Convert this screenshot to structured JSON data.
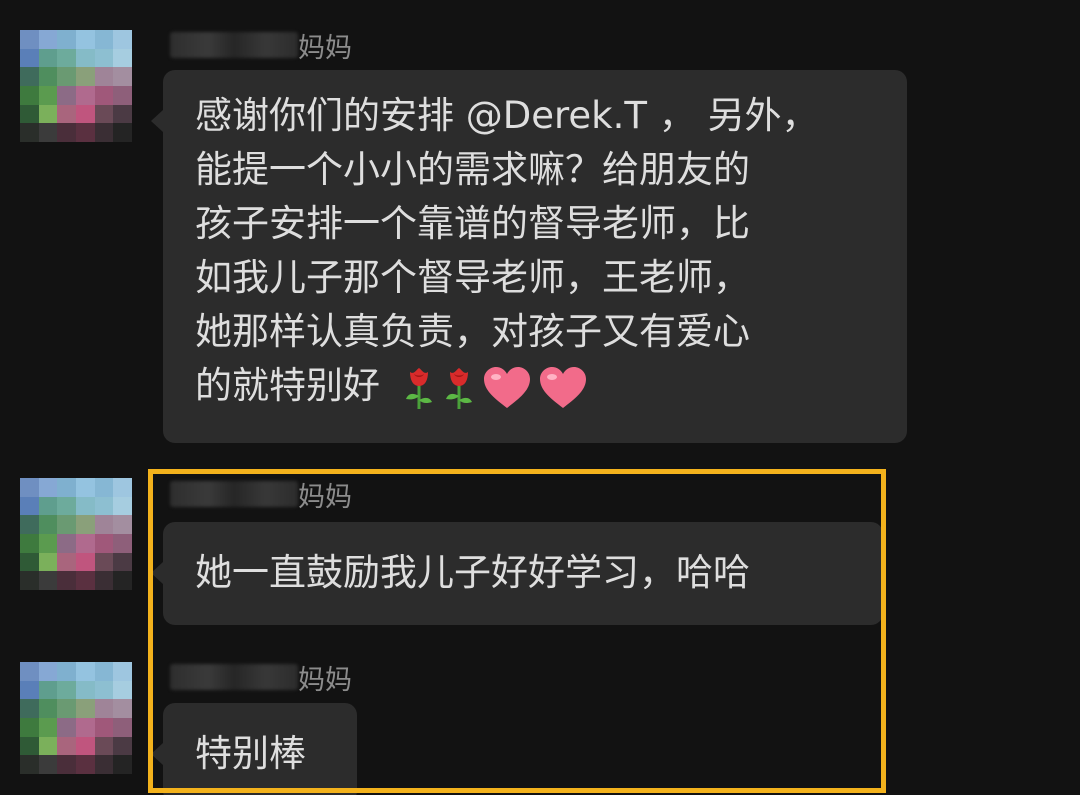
{
  "messages": [
    {
      "sender_suffix": "妈妈",
      "lines": [
        "感谢你们的安排 @Derek.T ， 另外，",
        "能提一个小小的需求嘛？给朋友的",
        "孩子安排一个靠谱的督导老师，比",
        "如我儿子那个督导老师，王老师，",
        "她那样认真负责，对孩子又有爱心",
        "的就特别好"
      ],
      "emojis": [
        "rose-emoji",
        "rose-emoji",
        "heart-emoji",
        "heart-emoji"
      ]
    },
    {
      "sender_suffix": "妈妈",
      "lines": [
        "她一直鼓励我儿子好好学习，哈哈"
      ]
    },
    {
      "sender_suffix": "妈妈",
      "lines": [
        "特别棒"
      ]
    }
  ],
  "colors": {
    "background": "#121212",
    "bubble": "#2c2c2c",
    "text": "#dedede",
    "sender_name": "#8c8c8c",
    "highlight": "#f3b21c"
  }
}
